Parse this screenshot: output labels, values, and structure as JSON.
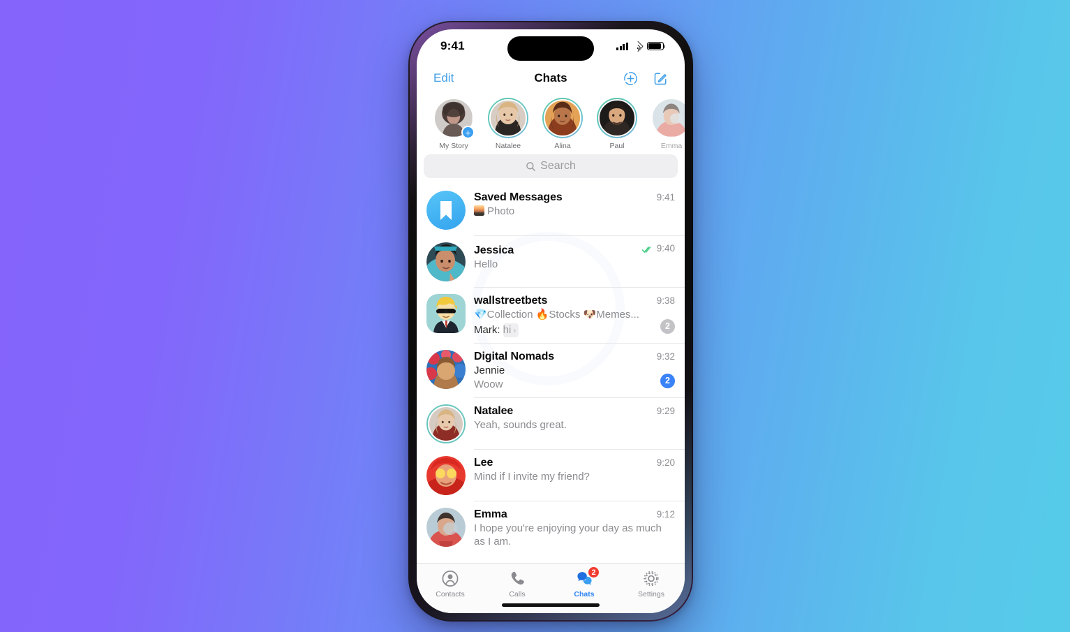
{
  "theme": {
    "bg_gradient_from": "#8366fb",
    "bg_gradient_to": "#58c6ea",
    "accent_blue": "#3a82f7",
    "link_blue": "#3e9fe8",
    "badge_red": "#f23b30",
    "muted_gray": "#c3c3c7",
    "tick_green": "#4cd08a"
  },
  "status_bar": {
    "time": "9:41",
    "signal_icon": "cellular-signal-icon",
    "wifi_icon": "wifi-icon",
    "battery_icon": "battery-icon"
  },
  "nav": {
    "edit_label": "Edit",
    "title": "Chats",
    "add_story_icon": "add-story-icon",
    "compose_icon": "compose-icon"
  },
  "stories": [
    {
      "name": "My Story",
      "ring": "none",
      "has_plus": true
    },
    {
      "name": "Natalee",
      "ring": "unseen",
      "has_plus": false
    },
    {
      "name": "Alina",
      "ring": "unseen",
      "has_plus": false
    },
    {
      "name": "Paul",
      "ring": "unseen",
      "has_plus": false
    },
    {
      "name": "Emma",
      "ring": "none",
      "has_plus": false
    }
  ],
  "search": {
    "placeholder": "Search",
    "icon": "search-icon"
  },
  "chats": [
    {
      "name": "Saved Messages",
      "time": "9:41",
      "preview": "Photo",
      "has_photo_thumb": true,
      "avatar_kind": "saved-messages-bookmark",
      "ticks": false,
      "badge": null
    },
    {
      "name": "Jessica",
      "time": "9:40",
      "preview": "Hello",
      "has_photo_thumb": false,
      "avatar_kind": "photo",
      "ticks": true,
      "badge": null
    },
    {
      "name": "wallstreetbets",
      "time": "9:38",
      "topics": "💎Collection 🔥Stocks 🐶Memes...",
      "reply_sender": "Mark:",
      "reply_text": "hi",
      "avatar_kind": "group-square",
      "ticks": false,
      "badge": {
        "count": "2",
        "style": "gray"
      }
    },
    {
      "name": "Digital Nomads",
      "time": "9:32",
      "sender": "Jennie",
      "preview": "Woow",
      "avatar_kind": "photo",
      "ticks": false,
      "badge": {
        "count": "2",
        "style": "blue"
      }
    },
    {
      "name": "Natalee",
      "time": "9:29",
      "preview": "Yeah, sounds great.",
      "avatar_kind": "photo-ringed",
      "ticks": false,
      "badge": null
    },
    {
      "name": "Lee",
      "time": "9:20",
      "preview": "Mind if I invite my friend?",
      "avatar_kind": "photo",
      "ticks": false,
      "badge": null
    },
    {
      "name": "Emma",
      "time": "9:12",
      "preview": "I hope you're enjoying your day as much as I am.",
      "avatar_kind": "photo",
      "ticks": false,
      "badge": null
    }
  ],
  "tabs": [
    {
      "label": "Contacts",
      "icon": "contacts-icon",
      "active": false,
      "badge": null
    },
    {
      "label": "Calls",
      "icon": "phone-icon",
      "active": false,
      "badge": null
    },
    {
      "label": "Chats",
      "icon": "chat-bubbles-icon",
      "active": true,
      "badge": "2"
    },
    {
      "label": "Settings",
      "icon": "gear-icon",
      "active": false,
      "badge": null
    }
  ]
}
